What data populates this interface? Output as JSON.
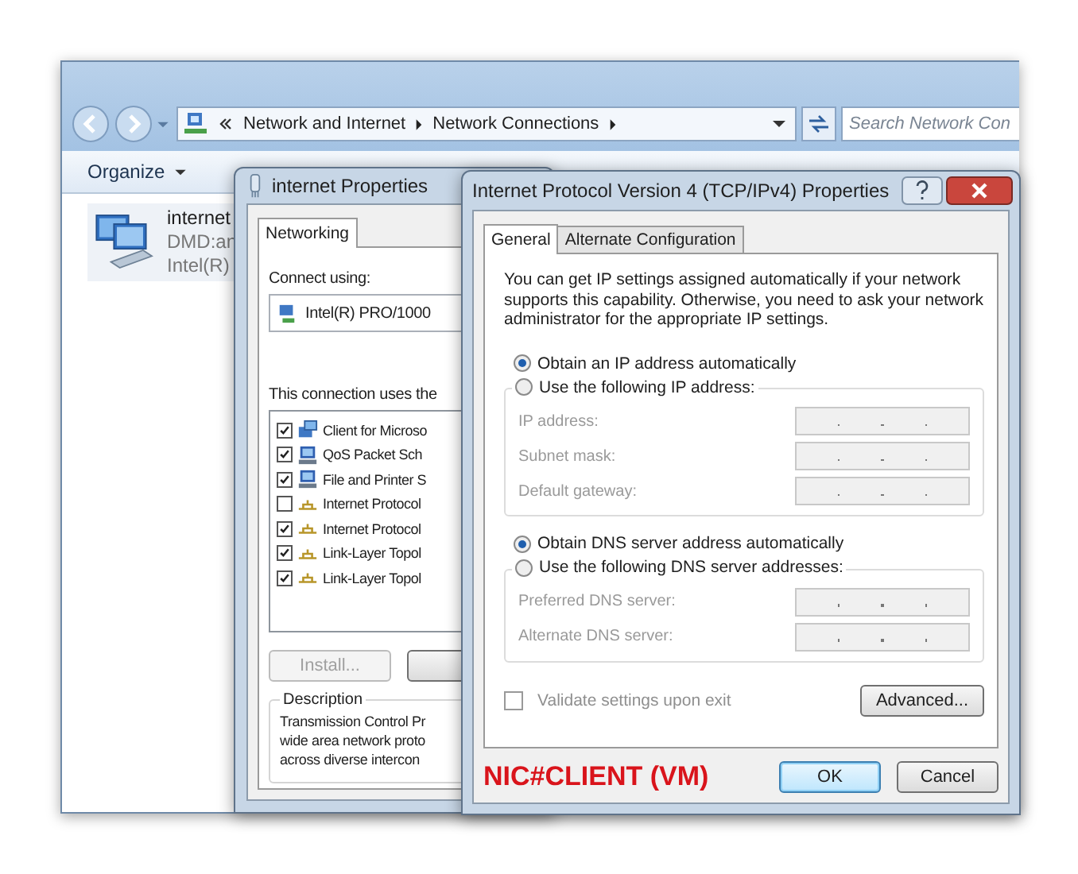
{
  "explorer": {
    "breadcrumb": [
      "Network and Internet",
      "Network Connections"
    ],
    "search": {
      "placeholder": "Search Network Con"
    },
    "toolbar": {
      "organize": "Organize"
    },
    "adapter": {
      "name": "internet",
      "lines": [
        "DMD:an",
        "Intel(R)"
      ]
    }
  },
  "nic_dialog": {
    "title": "internet Properties",
    "tabs": [
      {
        "label": "Networking",
        "selected": true
      }
    ],
    "connect_using_label": "Connect using:",
    "adapter": "Intel(R) PRO/1000",
    "items_label": "This connection uses the",
    "items": [
      {
        "label": "Client for Microso",
        "checked": true,
        "kind": "client"
      },
      {
        "label": "QoS Packet Sch",
        "checked": true,
        "kind": "service"
      },
      {
        "label": "File and Printer S",
        "checked": true,
        "kind": "service"
      },
      {
        "label": "Internet Protocol",
        "checked": false,
        "kind": "protocol"
      },
      {
        "label": "Internet Protocol",
        "checked": true,
        "kind": "protocol"
      },
      {
        "label": "Link-Layer Topol",
        "checked": true,
        "kind": "protocol"
      },
      {
        "label": "Link-Layer Topol",
        "checked": true,
        "kind": "protocol"
      }
    ],
    "install_button": {
      "label": "Install...",
      "disabled": true
    },
    "description": {
      "title": "Description",
      "lines": [
        "Transmission Control Pr",
        "wide area network proto",
        "across diverse intercon"
      ]
    }
  },
  "ipv4_dialog": {
    "title": "Internet Protocol Version 4 (TCP/IPv4) Properties",
    "tabs": [
      {
        "label": "General",
        "selected": true
      },
      {
        "label": "Alternate Configuration",
        "selected": false
      }
    ],
    "intro": "You can get IP settings assigned automatically if your network supports this capability. Otherwise, you need to ask your network administrator for the appropriate IP settings.",
    "ip_options": [
      {
        "label": "Obtain an IP address automatically",
        "selected": true
      },
      {
        "label": "Use the following IP address:",
        "selected": false
      }
    ],
    "ip_fields": [
      {
        "label": "IP address:",
        "disabled": true
      },
      {
        "label": "Subnet mask:",
        "disabled": true
      },
      {
        "label": "Default gateway:",
        "disabled": true
      }
    ],
    "dns_options": [
      {
        "label": "Obtain DNS server address automatically",
        "selected": true
      },
      {
        "label": "Use the following DNS server addresses:",
        "selected": false
      }
    ],
    "dns_fields": [
      {
        "label": "Preferred DNS server:",
        "disabled": true
      },
      {
        "label": "Alternate DNS server:",
        "disabled": true
      }
    ],
    "validate": {
      "label": "Validate settings upon exit",
      "checked": false,
      "disabled": true
    },
    "advanced_button": "Advanced...",
    "annotation": "NIC#CLIENT (VM)",
    "buttons": [
      {
        "label": "OK",
        "default": true
      },
      {
        "label": "Cancel",
        "default": false
      }
    ]
  }
}
